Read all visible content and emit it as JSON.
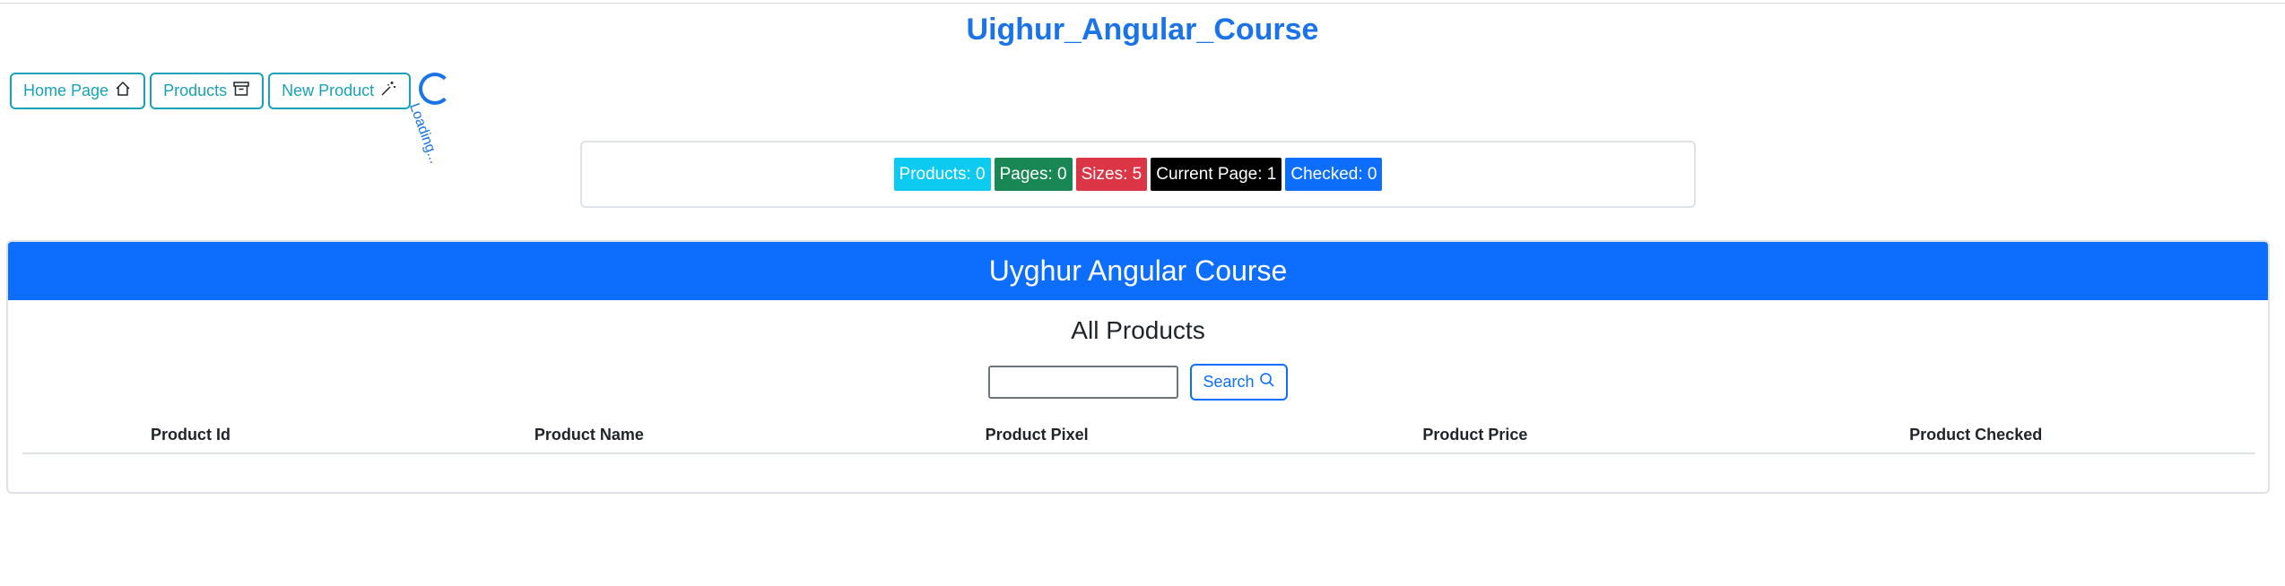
{
  "app": {
    "title": "Uighur_Angular_Course"
  },
  "nav": {
    "home_label": "Home Page",
    "products_label": "Products",
    "new_product_label": "New Product",
    "loading_text": "Loading..."
  },
  "stats": {
    "products": "Products: 0",
    "pages": "Pages: 0",
    "sizes": "Sizes: 5",
    "current_page": "Current Page: 1",
    "checked": "Checked: 0"
  },
  "card": {
    "header": "Uyghur Angular Course",
    "section_title": "All Products"
  },
  "search": {
    "value": "",
    "placeholder": "",
    "button_label": "Search"
  },
  "table": {
    "columns": [
      "Product Id",
      "Product Name",
      "Product Pixel",
      "Product Price",
      "Product Checked"
    ]
  },
  "colors": {
    "accent": "#0d6efd",
    "title": "#1a73e8",
    "info": "#17a2b8"
  }
}
